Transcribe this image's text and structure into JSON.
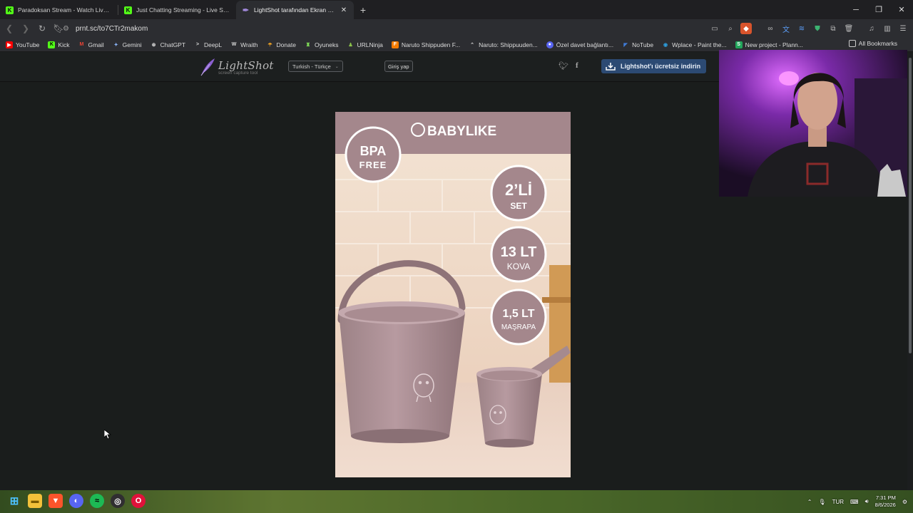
{
  "browser": {
    "tabs": [
      {
        "title": "Paradoksan Stream - Watch Live on K",
        "favicon": "kick-icon",
        "active": false
      },
      {
        "title": "Just Chatting Streaming - Live Stream",
        "favicon": "kick-icon",
        "active": false
      },
      {
        "title": "LightShot tarafından Ekran Görü",
        "favicon": "lightshot-icon",
        "active": true
      }
    ],
    "url": "prnt.sc/to7CTr2makom",
    "bookmarks": [
      {
        "label": "YouTube",
        "icon": "youtube-icon",
        "color": "#ff0000"
      },
      {
        "label": "Kick",
        "icon": "kick-icon",
        "color": "#53fc18"
      },
      {
        "label": "Gmail",
        "icon": "gmail-icon",
        "color": "#ea4335"
      },
      {
        "label": "Gemini",
        "icon": "gemini-icon",
        "color": "#8ab4f8"
      },
      {
        "label": "ChatGPT",
        "icon": "chatgpt-icon",
        "color": "#dddddd"
      },
      {
        "label": "DeepL",
        "icon": "deepl-icon",
        "color": "#0f2b46"
      },
      {
        "label": "Wraith",
        "icon": "wraith-icon",
        "color": "#dddddd"
      },
      {
        "label": "Donate",
        "icon": "donate-icon",
        "color": "#f5a623"
      },
      {
        "label": "Oyuneks",
        "icon": "oyuneks-icon",
        "color": "#7ed957"
      },
      {
        "label": "URLNinja",
        "icon": "urlninja-icon",
        "color": "#8bc34a"
      },
      {
        "label": "Naruto Shippuden F...",
        "icon": "naruto-icon",
        "color": "#f57c00"
      },
      {
        "label": "Naruto: Shippuuden...",
        "icon": "naruto-crunchy-icon",
        "color": "#dddddd"
      },
      {
        "label": "Özel davet bağlantı...",
        "icon": "discord-icon",
        "color": "#5865f2"
      },
      {
        "label": "NoTube",
        "icon": "notube-icon",
        "color": "#3f7bd6"
      },
      {
        "label": "Wplace - Paint the...",
        "icon": "wplace-icon",
        "color": "#2d9cdb"
      },
      {
        "label": "New project - Plann...",
        "icon": "planner-icon",
        "color": "#22a55b"
      }
    ],
    "all_bookmarks": "All Bookmarks"
  },
  "lightshot": {
    "logo_name": "LightShot",
    "logo_sub": "screen capture tool",
    "language": "Turkish - Türkçe",
    "login": "Giriş yap",
    "download": "Lightshot'ı ücretsiz indirin"
  },
  "product": {
    "brand": "BABYLIKE",
    "badge1_line1": "BPA",
    "badge1_line2": "FREE",
    "badge2_line1": "2’Lİ",
    "badge2_line2": "SET",
    "badge3_line1": "13 LT",
    "badge3_line2": "KOVA",
    "badge4_line1": "1,5 LT",
    "badge4_line2": "MAŞRAPA"
  },
  "taskbar": {
    "lang": "TUR",
    "time": "7:31 PM",
    "date": "8/6/2026"
  }
}
